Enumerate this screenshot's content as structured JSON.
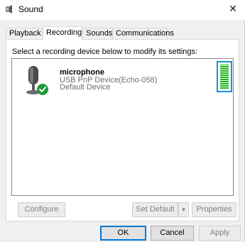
{
  "window": {
    "title": "Sound",
    "close_glyph": "✕"
  },
  "tabs": [
    {
      "label": "Playback",
      "active": false
    },
    {
      "label": "Recording",
      "active": true
    },
    {
      "label": "Sounds",
      "active": false
    },
    {
      "label": "Communications",
      "active": false
    }
  ],
  "panel": {
    "instruction": "Select a recording device below to modify its settings:"
  },
  "device": {
    "name": "microphone",
    "description": "USB PnP Device(Echo-058)",
    "status": "Default Device",
    "icon": "microphone-icon",
    "status_icon": "checkmark-icon",
    "level": 0.95
  },
  "buttons": {
    "configure": "Configure",
    "set_default": "Set Default",
    "set_default_arrow": "▼",
    "properties": "Properties",
    "ok": "OK",
    "cancel": "Cancel",
    "apply": "Apply"
  },
  "colors": {
    "selection_border": "#1a92d3",
    "level_green": "#1bb31b",
    "check_green": "#1e9b3a"
  }
}
